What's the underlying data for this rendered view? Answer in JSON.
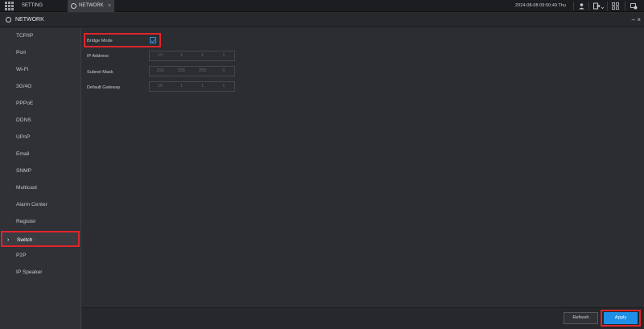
{
  "topbar": {
    "tabs": [
      {
        "label": "SETTING"
      },
      {
        "label": "NETWORK",
        "close": "×"
      }
    ],
    "datetime": "2024-08-08 09:50:49 Thu",
    "icons": [
      "user-icon",
      "logout-icon",
      "grid-icon",
      "device-icon"
    ]
  },
  "titlebar": {
    "title": "NETWORK",
    "controls": "– ×"
  },
  "sidebar": {
    "items": [
      {
        "label": "TCP/IP"
      },
      {
        "label": "Port"
      },
      {
        "label": "Wi-Fi"
      },
      {
        "label": "3G/4G"
      },
      {
        "label": "PPPoE"
      },
      {
        "label": "DDNS"
      },
      {
        "label": "UPnP"
      },
      {
        "label": "Email"
      },
      {
        "label": "SNMP"
      },
      {
        "label": "Multicast"
      },
      {
        "label": "Alarm Center"
      },
      {
        "label": "Register"
      },
      {
        "label": "Switch",
        "active": true
      },
      {
        "label": "P2P"
      },
      {
        "label": "IP Speaker"
      }
    ],
    "active_chevron": "›"
  },
  "form": {
    "bridge_mode_label": "Bridge Mode",
    "bridge_mode_checked": true,
    "ip_address_label": "IP Address",
    "ip_address": [
      "10",
      "1",
      "1",
      "1"
    ],
    "subnet_mask_label": "Subnet Mask",
    "subnet_mask": [
      "255",
      "255",
      "255",
      "0"
    ],
    "default_gateway_label": "Default Gateway",
    "default_gateway": [
      "10",
      "1",
      "1",
      "1"
    ]
  },
  "footer": {
    "refresh_label": "Refresh",
    "apply_label": "Apply"
  },
  "colors": {
    "accent": "#1e8fe8",
    "highlight": "#e0242b"
  }
}
